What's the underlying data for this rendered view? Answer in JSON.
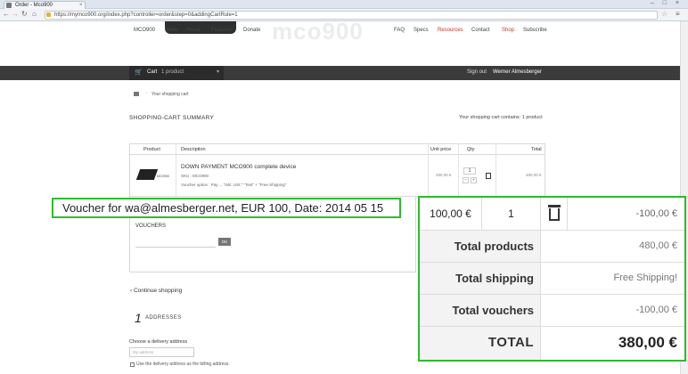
{
  "browser": {
    "tab_title": "Order - Mco900",
    "tab_close": "×",
    "url": "https://mymco900.org/index.php?controller=order&step=0&addingCartRule=1",
    "window_controls": "– □ ×"
  },
  "site": {
    "brand_watermark": "mco900",
    "nav": [
      "MCO900",
      "News",
      "About",
      "Features",
      "Donate"
    ],
    "nav_right": [
      "FAQ",
      "Specs",
      "Resources",
      "Contact",
      "Shop",
      "Subscribe"
    ],
    "cart_label": "Cart",
    "cart_count": "1 product",
    "sign_out": "Sign out",
    "user_name": "Werner Almesberger"
  },
  "breadcrumb": {
    "current": "Your shopping cart"
  },
  "summary": {
    "title": "SHOPPING-CART SUMMARY",
    "count_text": "Your shopping cart contains: 1 product"
  },
  "cart_table": {
    "headers": [
      "Product",
      "Description",
      "Unit price",
      "Qty",
      "Total"
    ],
    "row": {
      "image_text": "MCO900",
      "name": "DOWN PAYMENT MCO900 complete device",
      "ref": "SKU : MCO900",
      "attributes": "Voucher option : Pay ... \"Inkl. USt.\" \"Test\" + \"Free Shipping\"",
      "price": "480,00 €",
      "qty": "1",
      "minus": "−",
      "plus": "+",
      "total": "480,00 €"
    }
  },
  "vouchers": {
    "title": "VOUCHERS",
    "ok_label": "OK"
  },
  "callout": {
    "text": "Voucher for wa@almesberger.net, EUR 100, Date: 2014 05 15"
  },
  "zoom": {
    "price": "100,00 €",
    "qty": "1",
    "row_total": "-100,00 €",
    "rows": [
      {
        "label": "Total products",
        "value": "480,00 €"
      },
      {
        "label": "Total shipping",
        "value": "Free Shipping!"
      },
      {
        "label": "Total vouchers",
        "value": "-100,00 €"
      }
    ],
    "total_label": "TOTAL",
    "total_value": "380,00 €"
  },
  "continue_label": "Continue shopping",
  "step": {
    "number": "1",
    "label": "ADDRESSES"
  },
  "delivery": {
    "label": "Choose a delivery address",
    "select_value": "My address",
    "checkbox_label": "Use the delivery address as the billing address."
  }
}
